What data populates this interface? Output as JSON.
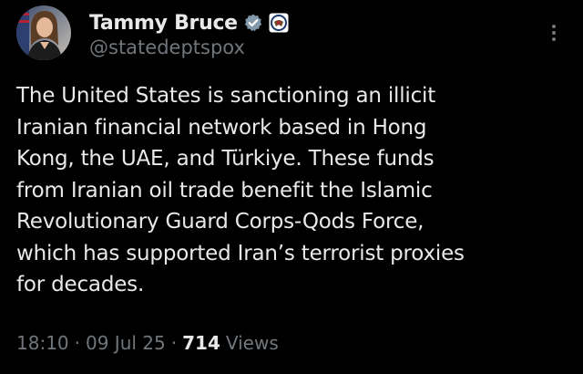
{
  "author": {
    "display_name": "Tammy Bruce",
    "handle": "@statedeptspox",
    "avatar_icon": "profile-photo-icon",
    "verified_icon": "gray-verified-badge-icon",
    "affiliation_icon": "state-department-seal-icon"
  },
  "tweet": {
    "text_lines": [
      "The United States is sanctioning an illicit",
      "Iranian financial network based in Hong",
      "Kong, the UAE, and Türkiye. These funds",
      "from Iranian oil trade benefit the Islamic",
      "Revolutionary Guard Corps-Qods Force,",
      "which has supported Iran’s terrorist proxies",
      "for decades."
    ]
  },
  "meta": {
    "time": "18:10",
    "separator": "·",
    "date": "09 Jul 25",
    "views_count": "714",
    "views_label": "Views"
  },
  "colors": {
    "background": "#000000",
    "primary_text": "#e7e9ea",
    "secondary_text": "#71767b",
    "badge_gray": "#829aab"
  }
}
